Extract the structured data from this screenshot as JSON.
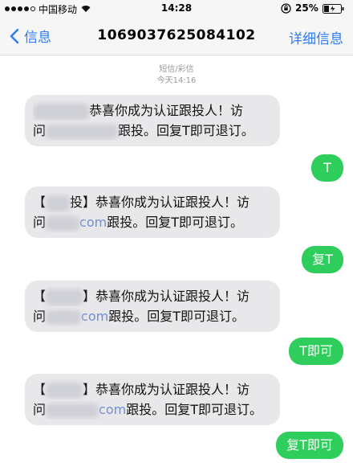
{
  "status_bar": {
    "carrier": "中国移动",
    "time": "14:28",
    "battery": "25%"
  },
  "nav": {
    "back_label": "信息",
    "title": "1069037625084102",
    "details_label": "详细信息"
  },
  "thread": {
    "header_type": "短信/彩信",
    "header_time": "今天14:16"
  },
  "messages": [
    {
      "direction": "incoming",
      "prefix": "",
      "line1": "恭喜你成为认证跟投人！访",
      "line2_pre": "问",
      "link": "",
      "line2_post": "跟投。回复T即可退订。"
    },
    {
      "direction": "outgoing",
      "text": "T"
    },
    {
      "direction": "incoming",
      "prefix": "【",
      "prefix_mid": "投】",
      "line1": "恭喜你成为认证跟投人！访",
      "line2_pre": "问",
      "link": "com",
      "line2_post": "跟投。回复T即可退订。"
    },
    {
      "direction": "outgoing",
      "text": "复T"
    },
    {
      "direction": "incoming",
      "prefix": "【",
      "prefix_mid": "】",
      "line1": "恭喜你成为认证跟投人！访",
      "line2_pre": "问",
      "link": "com",
      "line2_post": "跟投。回复T即可退订。"
    },
    {
      "direction": "outgoing",
      "text": "T即可"
    },
    {
      "direction": "incoming",
      "prefix": "【",
      "prefix_mid": "】",
      "line1": "恭喜你成为认证跟投人！访",
      "line2_pre": "问",
      "link": "com",
      "line2_post": "跟投。回复T即可退订。"
    },
    {
      "direction": "outgoing",
      "text": "复T即可"
    }
  ]
}
